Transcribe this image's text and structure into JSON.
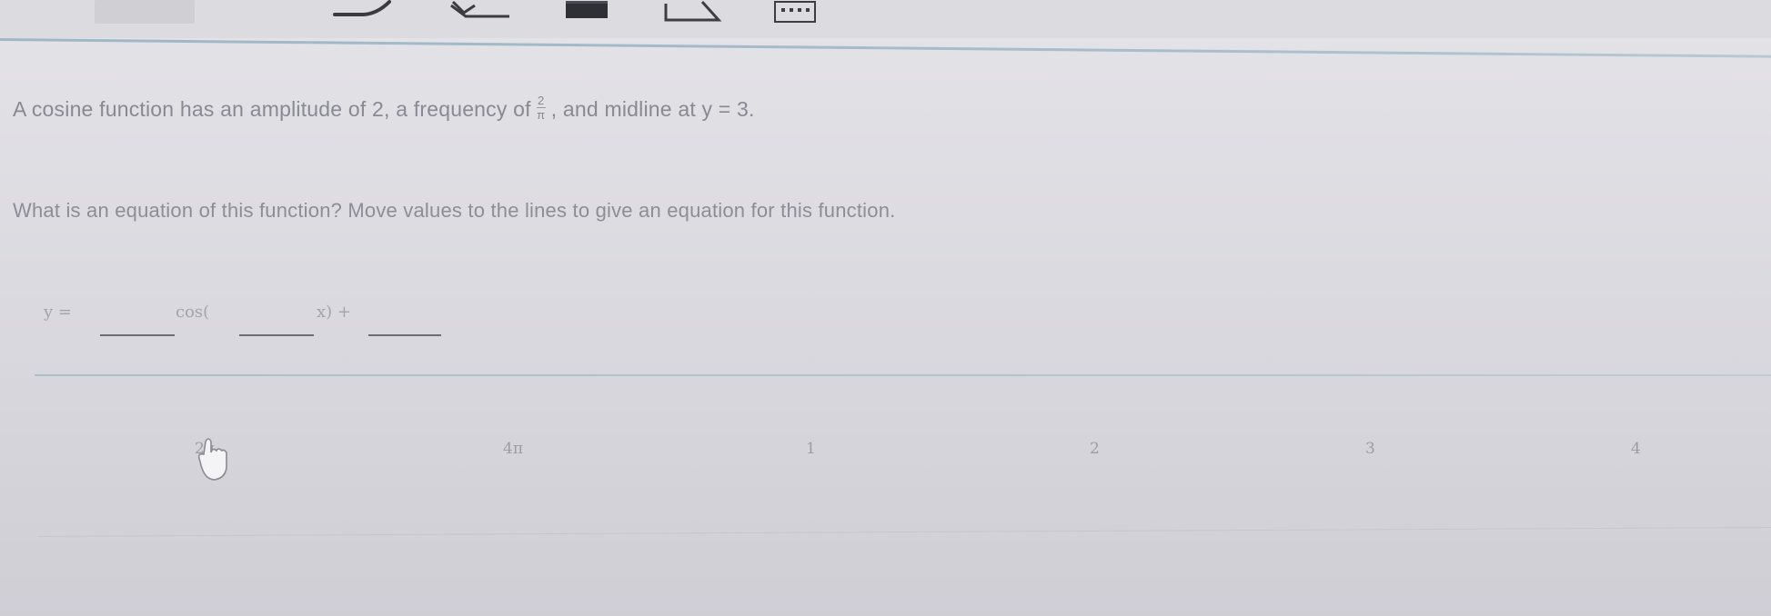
{
  "toolbar": {
    "tools": [
      {
        "icon": "tab-blank-icon"
      },
      {
        "icon": "pen-stroke-icon"
      },
      {
        "icon": "eraser-icon"
      },
      {
        "icon": "highlight-bar-icon"
      },
      {
        "icon": "ruler-triangle-icon"
      },
      {
        "icon": "calculator-icon"
      }
    ]
  },
  "question": {
    "text_before": "A cosine function has an amplitude of 2, a frequency of",
    "frac_num": "2",
    "frac_den": "π",
    "text_after": ", and midline at y = 3."
  },
  "prompt": {
    "text": "What is an equation of this function? Move values to the lines to give an equation for this function."
  },
  "equation": {
    "lhs": "y =",
    "cos": "cos(",
    "x_part": "x) +"
  },
  "tiles": [
    {
      "label": "2π"
    },
    {
      "label": "4π"
    },
    {
      "label": "1"
    },
    {
      "label": "2"
    },
    {
      "label": "3"
    },
    {
      "label": "4"
    }
  ],
  "colors": {
    "background": "#d7d6dc",
    "text": "#8e8e95",
    "rule": "#a6bccb"
  }
}
